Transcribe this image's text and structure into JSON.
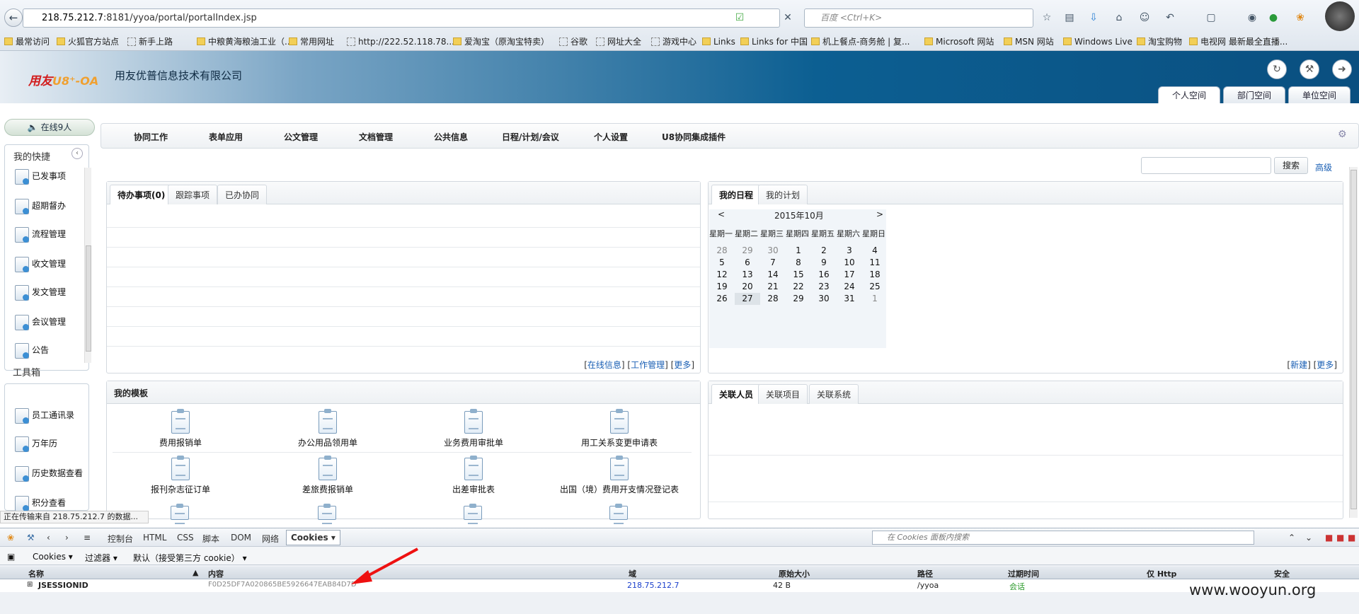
{
  "browser": {
    "url_host": "218.75.212.7",
    "url_rest": ":8181/yyoa/portal/portalIndex.jsp",
    "search_placeholder": "百度 <Ctrl+K>",
    "bookmarks": [
      "最常访问",
      "火狐官方站点",
      "新手上路",
      "中粮黄海粮油工业（...",
      "常用网址",
      "http://222.52.118.78...",
      "爱淘宝（原淘宝特卖）",
      "谷歌",
      "网址大全",
      "游戏中心",
      "Links",
      "Links for 中国",
      "机上餐点-商务舱 | 复...",
      "Microsoft 网站",
      "MSN 网站",
      "Windows Live",
      "淘宝购物",
      "电视网 最新最全直播..."
    ]
  },
  "header": {
    "logo_brand": "用友",
    "logo_product": "U8⁺-OA",
    "company": "用友优普信息技术有限公司",
    "space_tabs": [
      "个人空间",
      "部门空间",
      "单位空间"
    ]
  },
  "sidebar": {
    "online": "在线9人",
    "quick_title": "我的快捷",
    "quick_items": [
      "已发事项",
      "超期督办",
      "流程管理",
      "收文管理",
      "发文管理",
      "会议管理",
      "公告"
    ],
    "tools_title": "工具箱",
    "tool_items": [
      "员工通讯录",
      "万年历",
      "历史数据查看",
      "积分查看"
    ]
  },
  "menu": [
    "协同工作",
    "表单应用",
    "公文管理",
    "文档管理",
    "公共信息",
    "日程/计划/会议",
    "个人设置",
    "U8协同集成插件"
  ],
  "search": {
    "button": "搜索",
    "advanced": "高级"
  },
  "todo": {
    "tabs": [
      "待办事项(0)",
      "跟踪事项",
      "已办协同"
    ],
    "links": [
      "在线信息",
      "工作管理",
      "更多"
    ]
  },
  "schedule": {
    "tabs": [
      "我的日程",
      "我的计划"
    ],
    "calendar": {
      "prev": "<",
      "next": ">",
      "month": "2015年10月",
      "weekdays": [
        "星期一",
        "星期二",
        "星期三",
        "星期四",
        "星期五",
        "星期六",
        "星期日"
      ],
      "weeks": [
        [
          "28",
          "29",
          "30",
          "1",
          "2",
          "3",
          "4"
        ],
        [
          "5",
          "6",
          "7",
          "8",
          "9",
          "10",
          "11"
        ],
        [
          "12",
          "13",
          "14",
          "15",
          "16",
          "17",
          "18"
        ],
        [
          "19",
          "20",
          "21",
          "22",
          "23",
          "24",
          "25"
        ],
        [
          "26",
          "27",
          "28",
          "29",
          "30",
          "31",
          "1"
        ]
      ],
      "today": "27"
    },
    "links": [
      "新建",
      "更多"
    ]
  },
  "templates": {
    "title": "我的模板",
    "items": [
      "费用报销单",
      "办公用品领用单",
      "业务费用审批单",
      "用工关系变更申请表",
      "报刊杂志征订单",
      "差旅费报销单",
      "出差审批表",
      "出国（境）费用开支情况登记表"
    ]
  },
  "related": {
    "tabs": [
      "关联人员",
      "关联项目",
      "关联系统"
    ]
  },
  "status": "正在传输来自 218.75.212.7 的数据...",
  "devtools": {
    "tabs": [
      "控制台",
      "HTML",
      "CSS",
      "脚本",
      "DOM",
      "网络",
      "Cookies"
    ],
    "search_placeholder": "在 Cookies 面板内搜索",
    "sub": [
      "Cookies ▾",
      "过滤器 ▾",
      "默认（接受第三方 cookie） ▾"
    ],
    "columns": [
      "名称",
      "内容",
      "域",
      "原始大小",
      "路径",
      "过期时间",
      "仅 Http",
      "安全"
    ],
    "row": {
      "name": "JSESSIONID",
      "value": "F0D25DF7A020865BE5926647EAB84D7D",
      "domain": "218.75.212.7",
      "size": "42 B",
      "path": "/yyoa",
      "expires": "会话"
    }
  },
  "watermark": "www.wooyun.org"
}
